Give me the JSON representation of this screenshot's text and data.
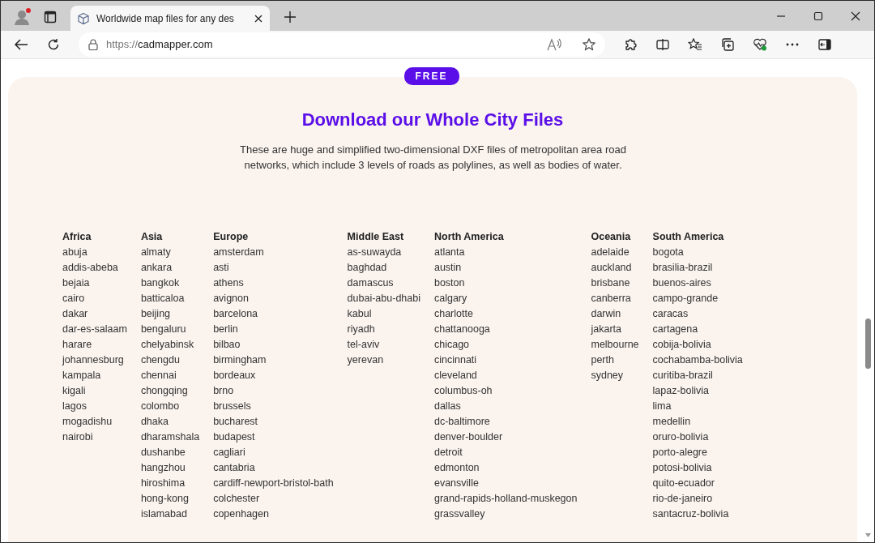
{
  "browser": {
    "tab": {
      "title": "Worldwide map files for any des"
    },
    "address": {
      "scheme": "https://",
      "host": "cadmapper.com"
    }
  },
  "page": {
    "badge": "FREE",
    "title": "Download our Whole City Files",
    "description": "These are huge and simplified two-dimensional DXF files of metropolitan area road networks, which include 3 levels of roads as polylines, as well as bodies of water.",
    "regions": [
      {
        "name": "Africa",
        "cities": [
          "abuja",
          "addis-abeba",
          "bejaia",
          "cairo",
          "dakar",
          "dar-es-salaam",
          "harare",
          "johannesburg",
          "kampala",
          "kigali",
          "lagos",
          "mogadishu",
          "nairobi"
        ]
      },
      {
        "name": "Asia",
        "cities": [
          "almaty",
          "ankara",
          "bangkok",
          "batticaloa",
          "beijing",
          "bengaluru",
          "chelyabinsk",
          "chengdu",
          "chennai",
          "chongqing",
          "colombo",
          "dhaka",
          "dharamshala",
          "dushanbe",
          "hangzhou",
          "hiroshima",
          "hong-kong",
          "islamabad"
        ]
      },
      {
        "name": "Europe",
        "cities": [
          "amsterdam",
          "asti",
          "athens",
          "avignon",
          "barcelona",
          "berlin",
          "bilbao",
          "birmingham",
          "bordeaux",
          "brno",
          "brussels",
          "bucharest",
          "budapest",
          "cagliari",
          "cantabria",
          "cardiff-newport-bristol-bath",
          "colchester",
          "copenhagen"
        ]
      },
      {
        "name": "Middle East",
        "cities": [
          "as-suwayda",
          "baghdad",
          "damascus",
          "dubai-abu-dhabi",
          "kabul",
          "riyadh",
          "tel-aviv",
          "yerevan"
        ]
      },
      {
        "name": "North America",
        "cities": [
          "atlanta",
          "austin",
          "boston",
          "calgary",
          "charlotte",
          "chattanooga",
          "chicago",
          "cincinnati",
          "cleveland",
          "columbus-oh",
          "dallas",
          "dc-baltimore",
          "denver-boulder",
          "detroit",
          "edmonton",
          "evansville",
          "grand-rapids-holland-muskegon",
          "grassvalley"
        ]
      },
      {
        "name": "Oceania",
        "cities": [
          "adelaide",
          "auckland",
          "brisbane",
          "canberra",
          "darwin",
          "jakarta",
          "melbourne",
          "perth",
          "sydney"
        ]
      },
      {
        "name": "South America",
        "cities": [
          "bogota",
          "brasilia-brazil",
          "buenos-aires",
          "campo-grande",
          "caracas",
          "cartagena",
          "cobija-bolivia",
          "cochabamba-bolivia",
          "curitiba-brazil",
          "lapaz-bolivia",
          "lima",
          "medellin",
          "oruro-bolivia",
          "porto-alegre",
          "potosi-bolivia",
          "quito-ecuador",
          "rio-de-janeiro",
          "santacruz-bolivia"
        ]
      }
    ]
  }
}
